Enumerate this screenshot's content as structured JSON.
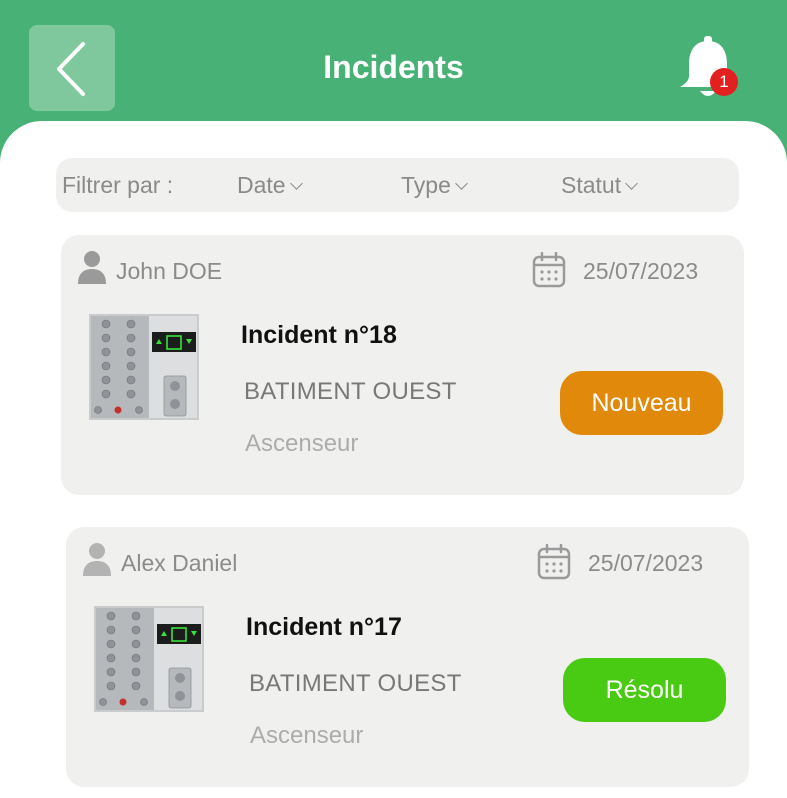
{
  "header": {
    "title": "Incidents",
    "notification_count": "1"
  },
  "filters": {
    "label": "Filtrer par :",
    "items": [
      "Date",
      "Type",
      "Statut"
    ]
  },
  "incidents": [
    {
      "user": "John DOE",
      "date": "25/07/2023",
      "title": "Incident n°18",
      "building": "BATIMENT OUEST",
      "type": "Ascenseur",
      "status": "Nouveau",
      "status_color": "#e1890a"
    },
    {
      "user": "Alex Daniel",
      "date": "25/07/2023",
      "title": "Incident n°17",
      "building": "BATIMENT OUEST",
      "type": "Ascenseur",
      "status": "Résolu",
      "status_color": "#48cb12"
    }
  ],
  "colors": {
    "header_green": "#48b175",
    "card_bg": "#f0f1ef"
  }
}
